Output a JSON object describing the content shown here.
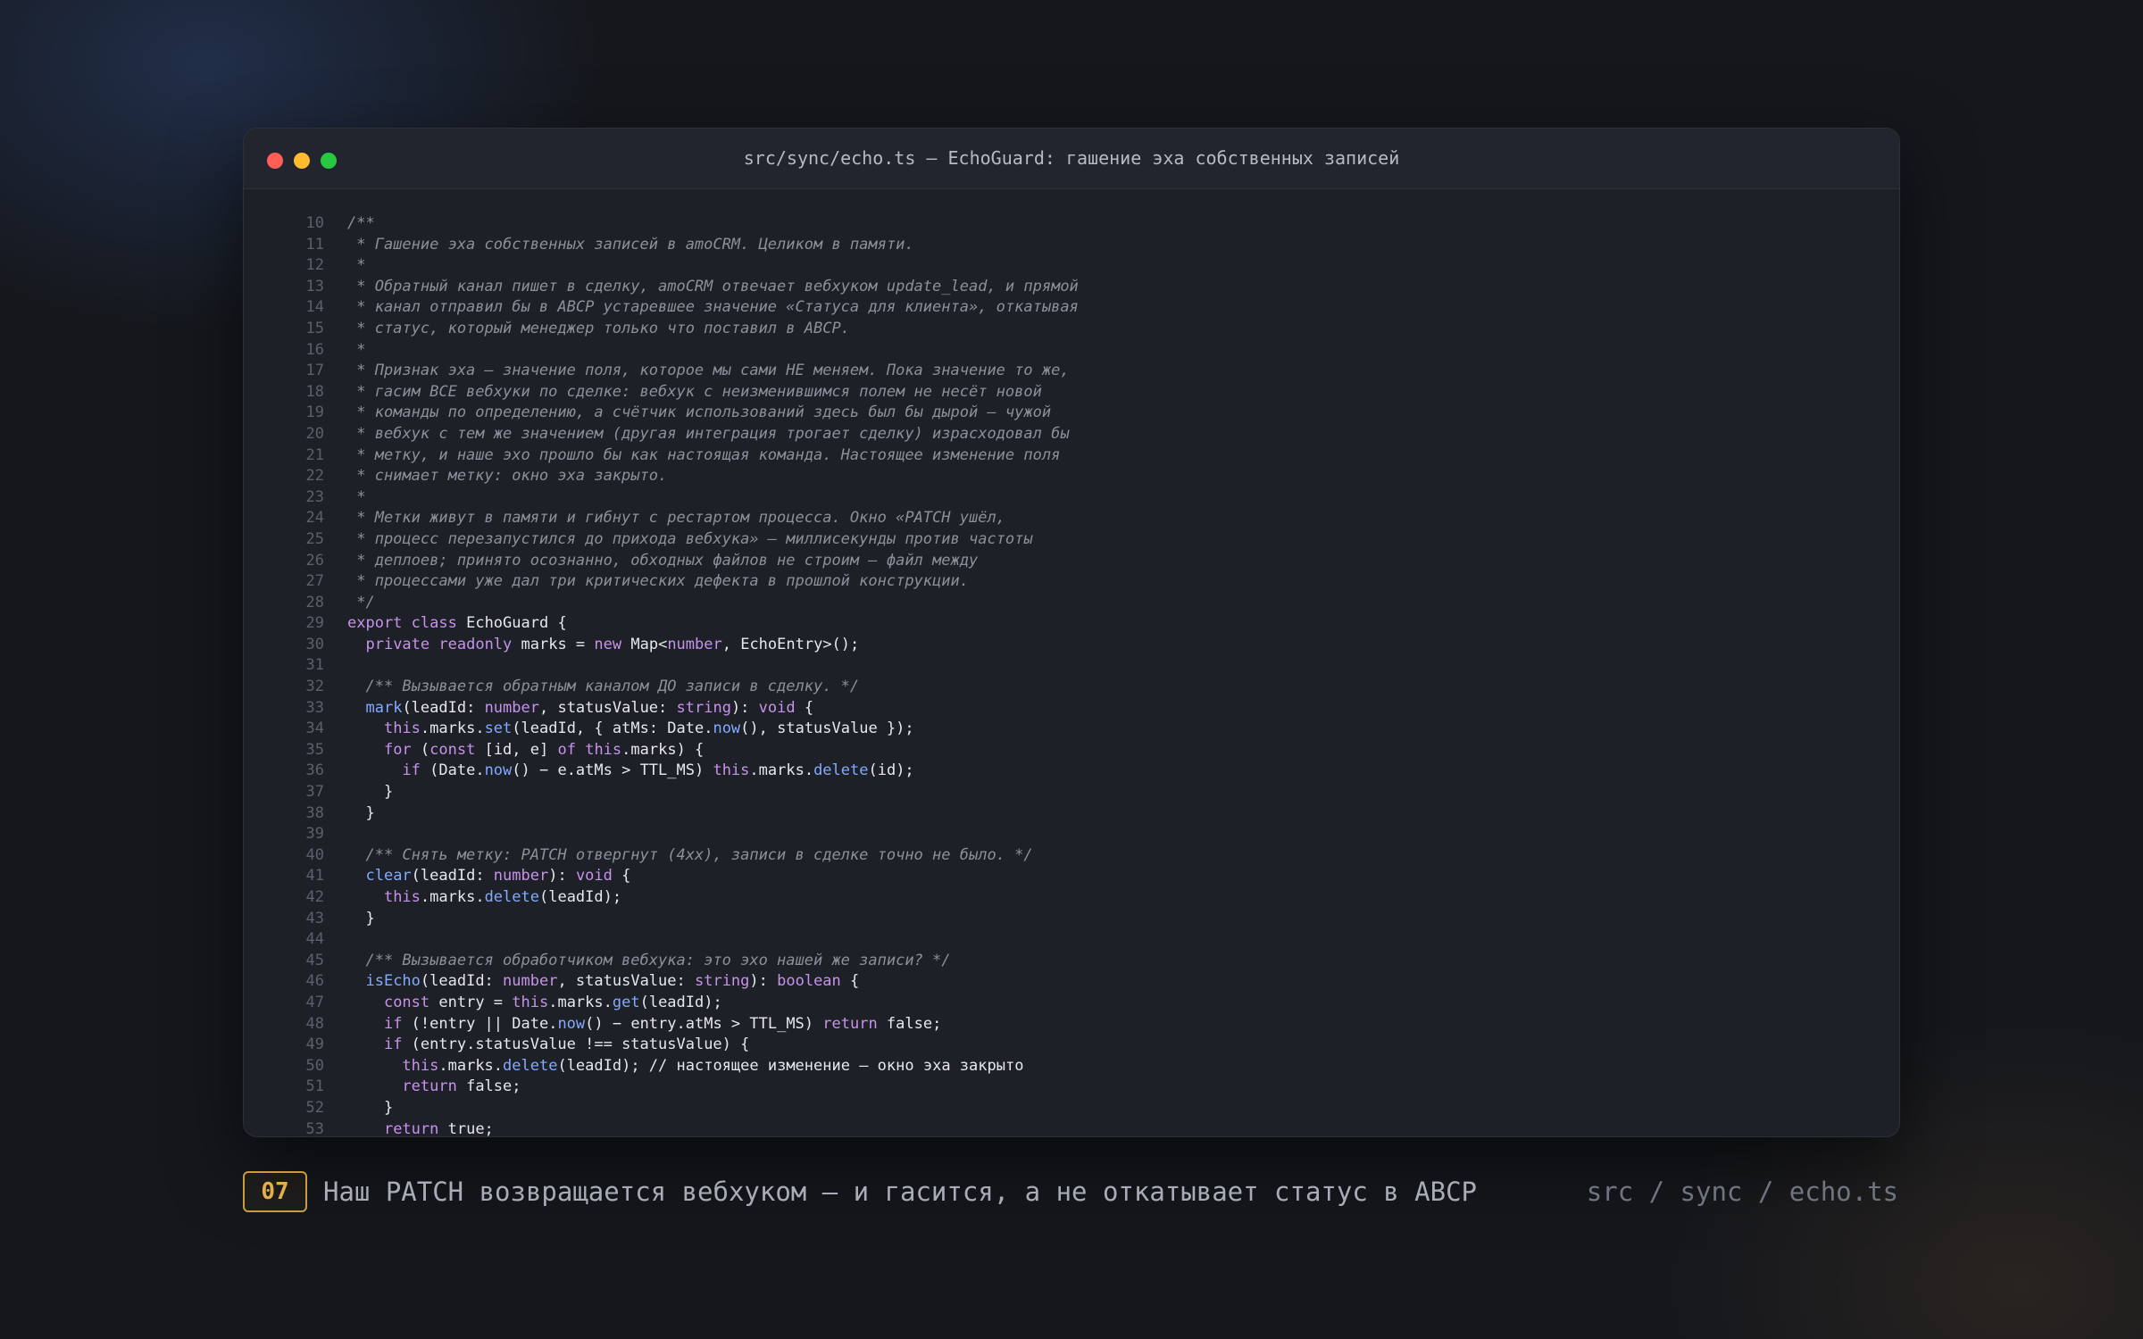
{
  "window": {
    "title": "src/sync/echo.ts — EchoGuard: гашение эха собственных записей"
  },
  "code": {
    "lines": [
      {
        "n": "10",
        "t": [
          [
            "cm",
            "/**"
          ]
        ]
      },
      {
        "n": "11",
        "t": [
          [
            "cm",
            " * Гашение эха собственных записей в amoCRM. Целиком в памяти."
          ]
        ]
      },
      {
        "n": "12",
        "t": [
          [
            "cm",
            " *"
          ]
        ]
      },
      {
        "n": "13",
        "t": [
          [
            "cm",
            " * Обратный канал пишет в сделку, amoCRM отвечает вебхуком update_lead, и прямой"
          ]
        ]
      },
      {
        "n": "14",
        "t": [
          [
            "cm",
            " * канал отправил бы в АВСР устаревшее значение «Статуса для клиента», откатывая"
          ]
        ]
      },
      {
        "n": "15",
        "t": [
          [
            "cm",
            " * статус, который менеджер только что поставил в АВСР."
          ]
        ]
      },
      {
        "n": "16",
        "t": [
          [
            "cm",
            " *"
          ]
        ]
      },
      {
        "n": "17",
        "t": [
          [
            "cm",
            " * Признак эха — значение поля, которое мы сами НЕ меняем. Пока значение то же,"
          ]
        ]
      },
      {
        "n": "18",
        "t": [
          [
            "cm",
            " * гасим ВСЕ вебхуки по сделке: вебхук с неизменившимся полем не несёт новой"
          ]
        ]
      },
      {
        "n": "19",
        "t": [
          [
            "cm",
            " * команды по определению, а счётчик использований здесь был бы дырой — чужой"
          ]
        ]
      },
      {
        "n": "20",
        "t": [
          [
            "cm",
            " * вебхук с тем же значением (другая интеграция трогает сделку) израсходовал бы"
          ]
        ]
      },
      {
        "n": "21",
        "t": [
          [
            "cm",
            " * метку, и наше эхо прошло бы как настоящая команда. Настоящее изменение поля"
          ]
        ]
      },
      {
        "n": "22",
        "t": [
          [
            "cm",
            " * снимает метку: окно эха закрыто."
          ]
        ]
      },
      {
        "n": "23",
        "t": [
          [
            "cm",
            " *"
          ]
        ]
      },
      {
        "n": "24",
        "t": [
          [
            "cm",
            " * Метки живут в памяти и гибнут с рестартом процесса. Окно «PATCH ушёл,"
          ]
        ]
      },
      {
        "n": "25",
        "t": [
          [
            "cm",
            " * процесс перезапустился до прихода вебхука» — миллисекунды против частоты"
          ]
        ]
      },
      {
        "n": "26",
        "t": [
          [
            "cm",
            " * деплоев; принято осознанно, обходных файлов не строим — файл между"
          ]
        ]
      },
      {
        "n": "27",
        "t": [
          [
            "cm",
            " * процессами уже дал три критических дефекта в прошлой конструкции."
          ]
        ]
      },
      {
        "n": "28",
        "t": [
          [
            "cm",
            " */"
          ]
        ]
      },
      {
        "n": "29",
        "t": [
          [
            "kw",
            "export"
          ],
          [
            "p",
            " "
          ],
          [
            "kw",
            "class"
          ],
          [
            "p",
            " EchoGuard {"
          ]
        ]
      },
      {
        "n": "30",
        "t": [
          [
            "p",
            "  "
          ],
          [
            "kw",
            "private"
          ],
          [
            "p",
            " "
          ],
          [
            "kw",
            "readonly"
          ],
          [
            "p",
            " marks = "
          ],
          [
            "kw",
            "new"
          ],
          [
            "p",
            " Map<"
          ],
          [
            "ty",
            "number"
          ],
          [
            "p",
            ", EchoEntry>();"
          ]
        ]
      },
      {
        "n": "31",
        "t": [
          [
            "p",
            ""
          ]
        ]
      },
      {
        "n": "32",
        "t": [
          [
            "cm",
            "  /** Вызывается обратным каналом ДО записи в сделку. */"
          ]
        ]
      },
      {
        "n": "33",
        "t": [
          [
            "p",
            "  "
          ],
          [
            "fn",
            "mark"
          ],
          [
            "p",
            "(leadId: "
          ],
          [
            "ty",
            "number"
          ],
          [
            "p",
            ", statusValue: "
          ],
          [
            "ty",
            "string"
          ],
          [
            "p",
            "): "
          ],
          [
            "ty",
            "void"
          ],
          [
            "p",
            " {"
          ]
        ]
      },
      {
        "n": "34",
        "t": [
          [
            "p",
            "    "
          ],
          [
            "kw",
            "this"
          ],
          [
            "p",
            ".marks."
          ],
          [
            "fn",
            "set"
          ],
          [
            "p",
            "(leadId, { atMs: Date."
          ],
          [
            "fn",
            "now"
          ],
          [
            "p",
            "(), statusValue });"
          ]
        ]
      },
      {
        "n": "35",
        "t": [
          [
            "p",
            "    "
          ],
          [
            "kw",
            "for"
          ],
          [
            "p",
            " ("
          ],
          [
            "kw",
            "const"
          ],
          [
            "p",
            " [id, e] "
          ],
          [
            "kw",
            "of"
          ],
          [
            "p",
            " "
          ],
          [
            "kw",
            "this"
          ],
          [
            "p",
            ".marks) {"
          ]
        ]
      },
      {
        "n": "36",
        "t": [
          [
            "p",
            "      "
          ],
          [
            "kw",
            "if"
          ],
          [
            "p",
            " (Date."
          ],
          [
            "fn",
            "now"
          ],
          [
            "p",
            "() − e.atMs > TTL_MS) "
          ],
          [
            "kw",
            "this"
          ],
          [
            "p",
            ".marks."
          ],
          [
            "fn",
            "delete"
          ],
          [
            "p",
            "(id);"
          ]
        ]
      },
      {
        "n": "37",
        "t": [
          [
            "p",
            "    }"
          ]
        ]
      },
      {
        "n": "38",
        "t": [
          [
            "p",
            "  }"
          ]
        ]
      },
      {
        "n": "39",
        "t": [
          [
            "p",
            ""
          ]
        ]
      },
      {
        "n": "40",
        "t": [
          [
            "cm",
            "  /** Снять метку: PATCH отвергнут (4xx), записи в сделке точно не было. */"
          ]
        ]
      },
      {
        "n": "41",
        "t": [
          [
            "p",
            "  "
          ],
          [
            "fn",
            "clear"
          ],
          [
            "p",
            "(leadId: "
          ],
          [
            "ty",
            "number"
          ],
          [
            "p",
            "): "
          ],
          [
            "ty",
            "void"
          ],
          [
            "p",
            " {"
          ]
        ]
      },
      {
        "n": "42",
        "t": [
          [
            "p",
            "    "
          ],
          [
            "kw",
            "this"
          ],
          [
            "p",
            ".marks."
          ],
          [
            "fn",
            "delete"
          ],
          [
            "p",
            "(leadId);"
          ]
        ]
      },
      {
        "n": "43",
        "t": [
          [
            "p",
            "  }"
          ]
        ]
      },
      {
        "n": "44",
        "t": [
          [
            "p",
            ""
          ]
        ]
      },
      {
        "n": "45",
        "t": [
          [
            "cm",
            "  /** Вызывается обработчиком вебхука: это эхо нашей же записи? */"
          ]
        ]
      },
      {
        "n": "46",
        "t": [
          [
            "p",
            "  "
          ],
          [
            "fn",
            "isEcho"
          ],
          [
            "p",
            "(leadId: "
          ],
          [
            "ty",
            "number"
          ],
          [
            "p",
            ", statusValue: "
          ],
          [
            "ty",
            "string"
          ],
          [
            "p",
            "): "
          ],
          [
            "ty",
            "boolean"
          ],
          [
            "p",
            " {"
          ]
        ]
      },
      {
        "n": "47",
        "t": [
          [
            "p",
            "    "
          ],
          [
            "kw",
            "const"
          ],
          [
            "p",
            " entry = "
          ],
          [
            "kw",
            "this"
          ],
          [
            "p",
            ".marks."
          ],
          [
            "fn",
            "get"
          ],
          [
            "p",
            "(leadId);"
          ]
        ]
      },
      {
        "n": "48",
        "t": [
          [
            "p",
            "    "
          ],
          [
            "kw",
            "if"
          ],
          [
            "p",
            " (!entry || Date."
          ],
          [
            "fn",
            "now"
          ],
          [
            "p",
            "() − entry.atMs > TTL_MS) "
          ],
          [
            "kw",
            "return"
          ],
          [
            "p",
            " false;"
          ]
        ]
      },
      {
        "n": "49",
        "t": [
          [
            "p",
            "    "
          ],
          [
            "kw",
            "if"
          ],
          [
            "p",
            " (entry.statusValue !== statusValue) {"
          ]
        ]
      },
      {
        "n": "50",
        "t": [
          [
            "p",
            "      "
          ],
          [
            "kw",
            "this"
          ],
          [
            "p",
            ".marks."
          ],
          [
            "fn",
            "delete"
          ],
          [
            "p",
            "(leadId); // настоящее изменение — окно эха закрыто"
          ]
        ]
      },
      {
        "n": "51",
        "t": [
          [
            "p",
            "      "
          ],
          [
            "kw",
            "return"
          ],
          [
            "p",
            " false;"
          ]
        ]
      },
      {
        "n": "52",
        "t": [
          [
            "p",
            "    }"
          ]
        ]
      },
      {
        "n": "53",
        "t": [
          [
            "p",
            "    "
          ],
          [
            "kw",
            "return"
          ],
          [
            "p",
            " true;"
          ]
        ]
      }
    ]
  },
  "caption": {
    "badge": "07",
    "text": "Наш PATCH возвращается вебхуком — и гасится, а не откатывает статус в АВСР",
    "path": "src / sync / echo.ts"
  }
}
